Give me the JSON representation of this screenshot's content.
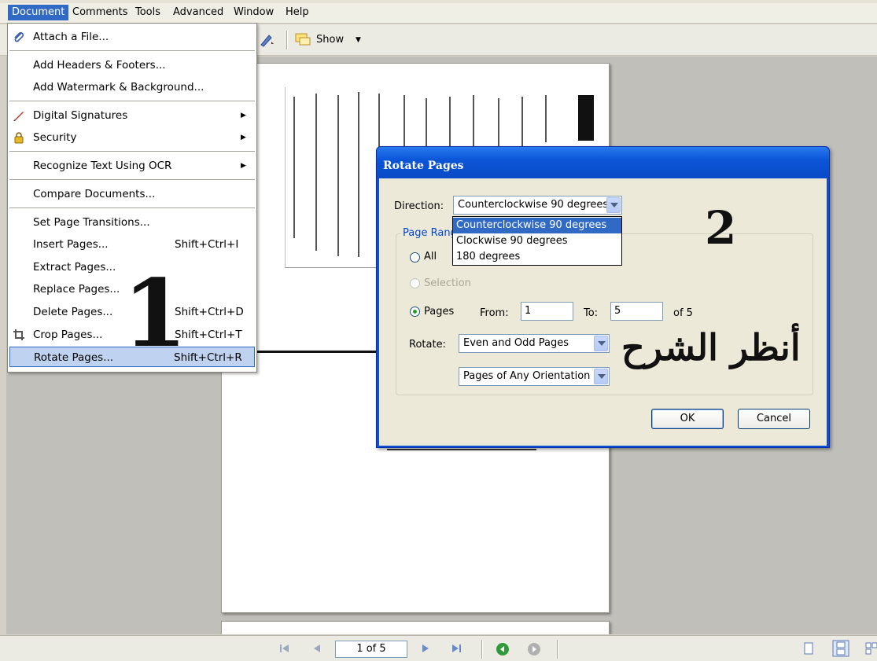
{
  "menubar": {
    "items": [
      "Document",
      "Comments",
      "Tools",
      "Advanced",
      "Window",
      "Help"
    ]
  },
  "toolbar": {
    "show_label": "Show"
  },
  "document_menu": {
    "attach_file": "Attach a File...",
    "add_headers_footers": "Add Headers & Footers...",
    "add_watermark": "Add Watermark & Background...",
    "digital_signatures": "Digital Signatures",
    "security": "Security",
    "recognize_text": "Recognize Text Using OCR",
    "compare_documents": "Compare Documents...",
    "set_page_transitions": "Set Page Transitions...",
    "insert_pages": "Insert Pages...",
    "insert_pages_shortcut": "Shift+Ctrl+I",
    "extract_pages": "Extract Pages...",
    "replace_pages": "Replace Pages...",
    "delete_pages": "Delete Pages...",
    "delete_pages_shortcut": "Shift+Ctrl+D",
    "crop_pages": "Crop Pages...",
    "crop_pages_shortcut": "Shift+Ctrl+T",
    "rotate_pages": "Rotate Pages...",
    "rotate_pages_shortcut": "Shift+Ctrl+R"
  },
  "dialog": {
    "title": "Rotate Pages",
    "direction_label": "Direction:",
    "direction_value": "Counterclockwise 90 degrees",
    "direction_options": [
      "Counterclockwise 90 degrees",
      "Clockwise 90 degrees",
      "180 degrees"
    ],
    "page_range_label": "Page Range",
    "all_label": "All",
    "selection_label": "Selection",
    "pages_label": "Pages",
    "from_label": "From:",
    "from_value": "1",
    "to_label": "To:",
    "to_value": "5",
    "of_label": "of 5",
    "rotate_label": "Rotate:",
    "rotate_value": "Even and Odd Pages",
    "orientation_value": "Pages of Any Orientation",
    "ok_label": "OK",
    "cancel_label": "Cancel"
  },
  "statusbar": {
    "page_indicator": "1 of 5"
  },
  "annotations": {
    "step1": "1",
    "step2": "2",
    "arabic_note": "أنظر الشرح"
  }
}
